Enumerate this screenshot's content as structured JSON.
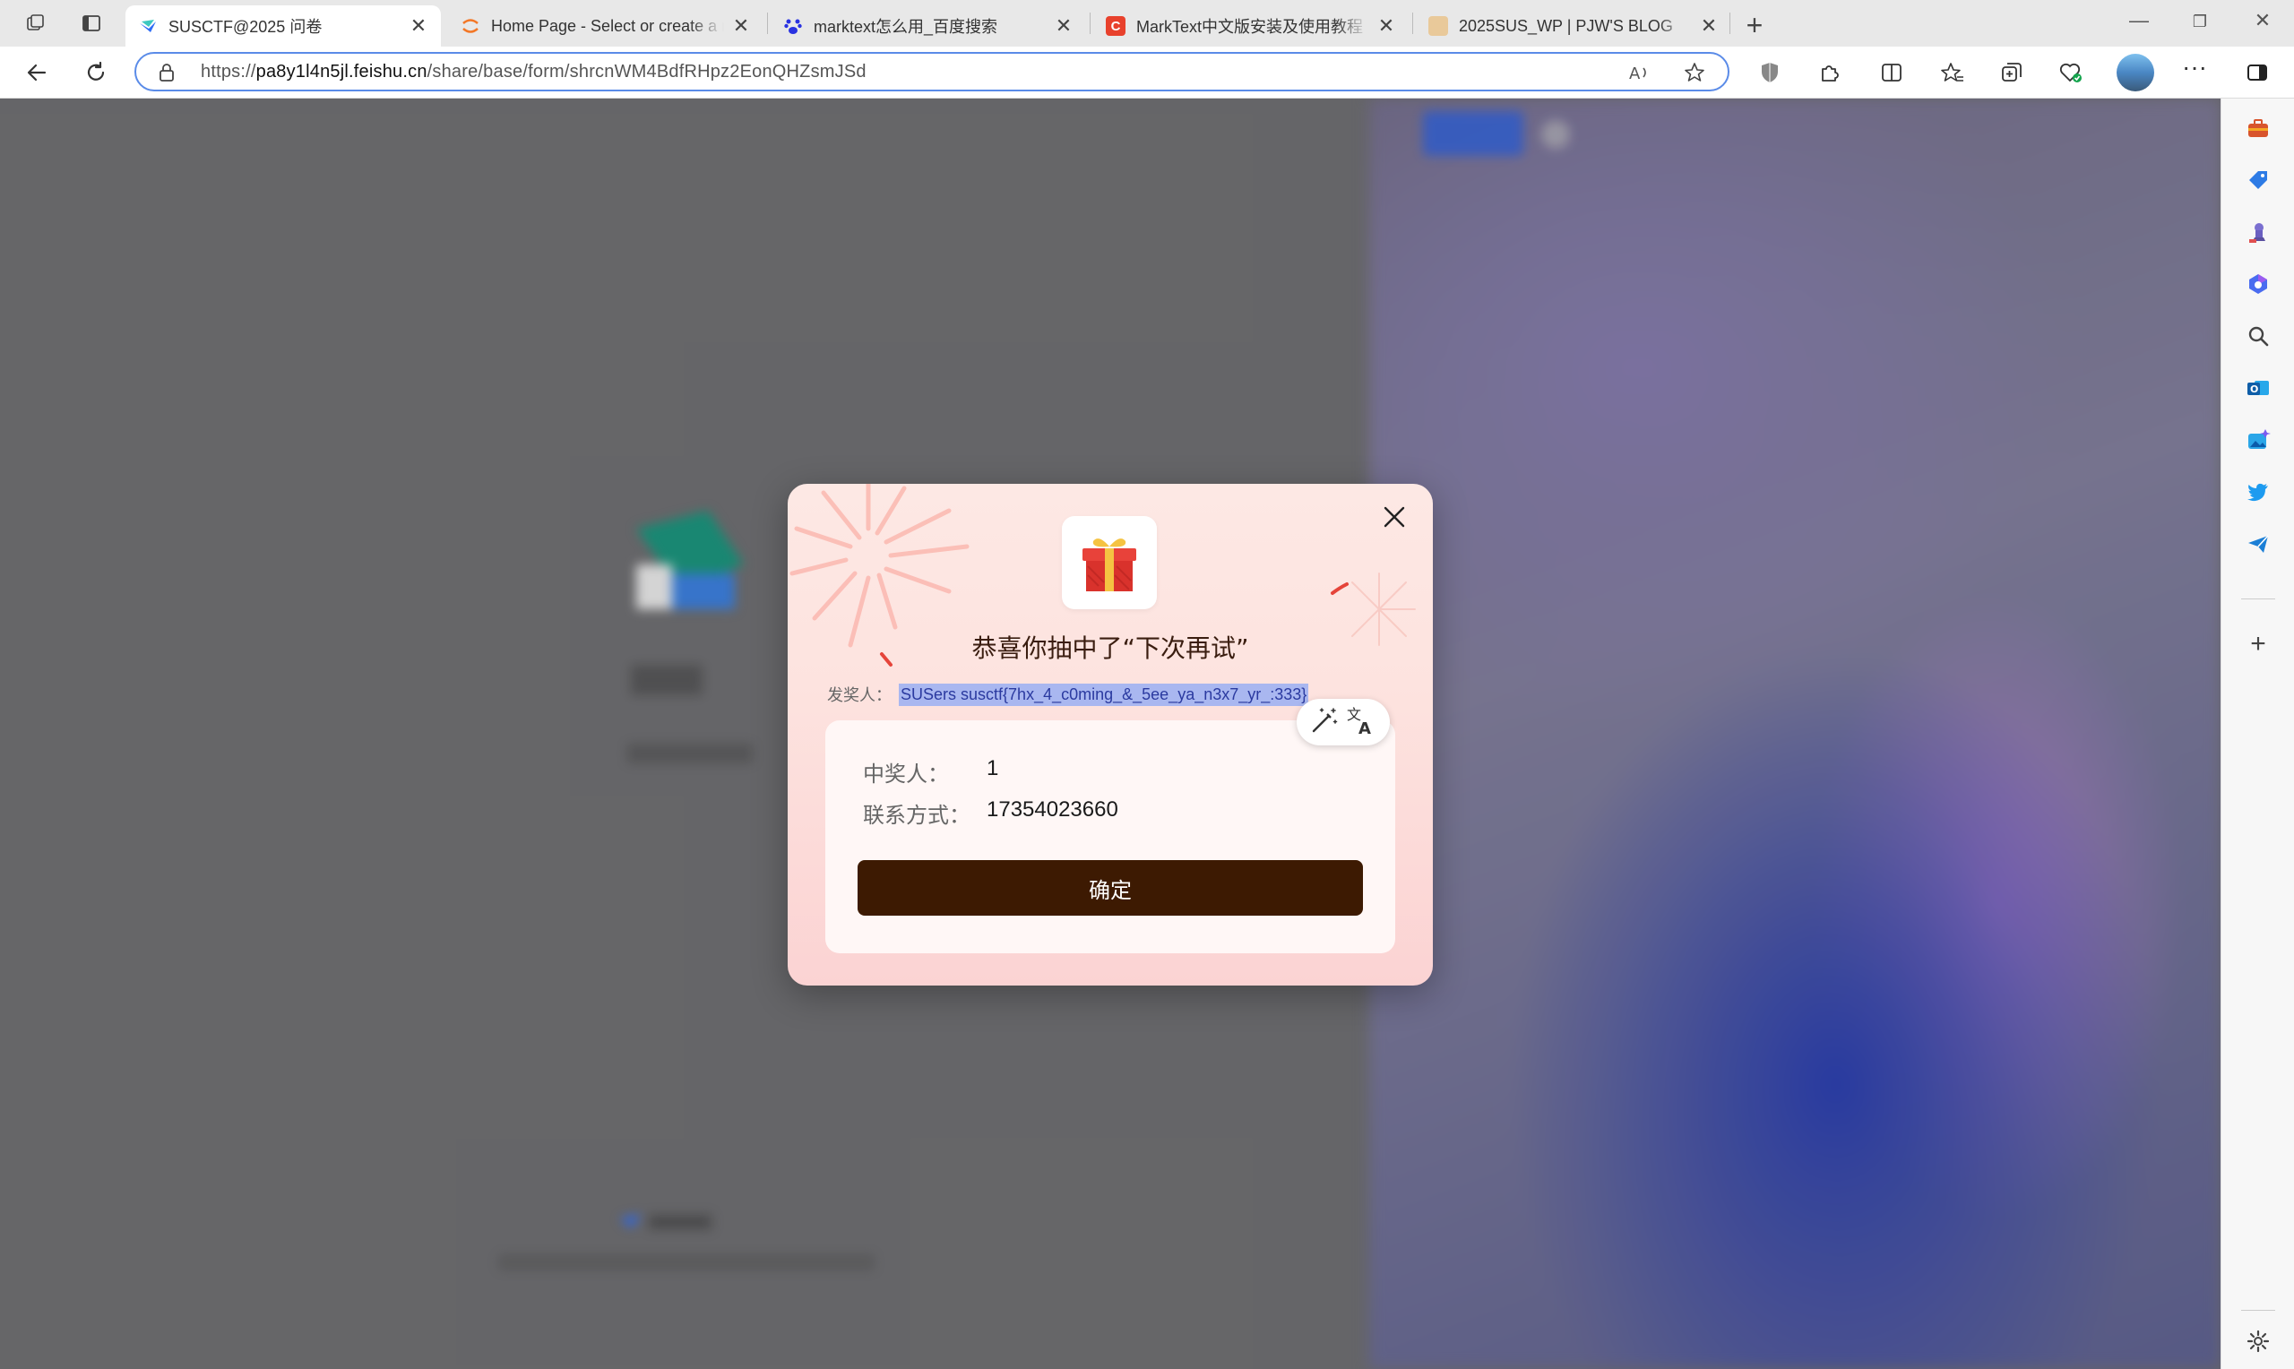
{
  "browser": {
    "tabs": [
      {
        "title": "SUSCTF@2025 问卷",
        "active": true
      },
      {
        "title": "Home Page - Select or create a n",
        "active": false
      },
      {
        "title": "marktext怎么用_百度搜索",
        "active": false
      },
      {
        "title": "MarkText中文版安装及使用教程",
        "active": false
      },
      {
        "title": "2025SUS_WP | PJW'S BLOG",
        "active": false
      }
    ],
    "url_prefix": "https://",
    "url_host": "pa8y1l4n5jl.feishu.cn",
    "url_path": "/share/base/form/shrcnWM4BdfRHpz2EonQHZsmJSd"
  },
  "dialog": {
    "title": "恭喜你抽中了“下次再试”",
    "sender_label": "发奖人：",
    "sender_value": "SUSers susctf{7hx_4_c0ming_&_5ee_ya_n3x7_yr_:333}",
    "winner_label": "中奖人：",
    "winner_value": "1",
    "contact_label": "联系方式：",
    "contact_value": "17354023660",
    "confirm_label": "确定"
  },
  "colors": {
    "accent": "#3d1a02",
    "selection": "#a9b7f0",
    "omnibox_border": "#5a8be8"
  },
  "icons": {
    "sidebar": [
      "briefcase-icon",
      "tag-icon",
      "chess-icon",
      "copilot-icon",
      "search-icon",
      "outlook-icon",
      "image-creator-icon",
      "twitter-icon",
      "send-icon",
      "add-icon",
      "settings-icon"
    ]
  }
}
